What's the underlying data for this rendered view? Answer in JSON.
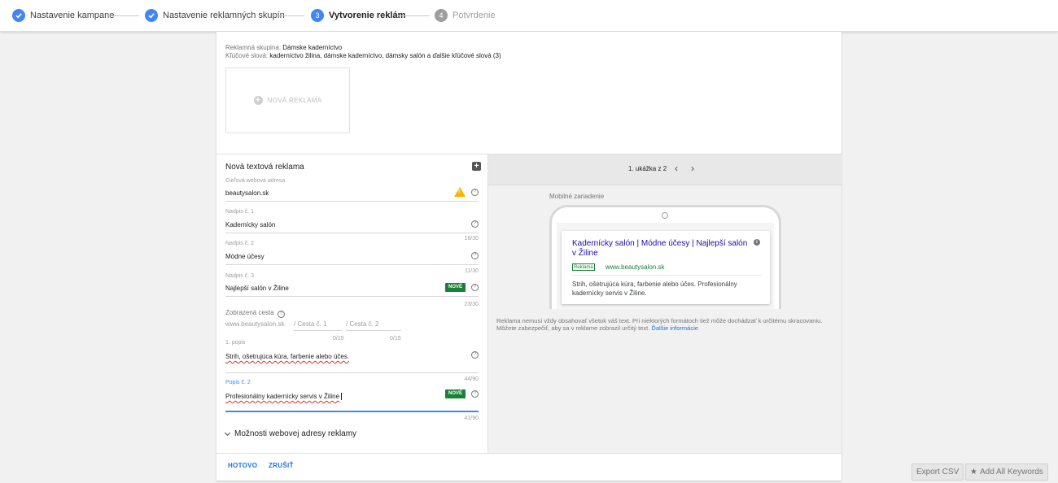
{
  "stepper": {
    "steps": [
      {
        "label": "Nastavenie kampane",
        "status": "done"
      },
      {
        "label": "Nastavenie reklamných skupín",
        "status": "done"
      },
      {
        "label": "Vytvorenie reklám",
        "number": "3",
        "status": "active"
      },
      {
        "label": "Potvrdenie",
        "number": "4",
        "status": "future"
      }
    ]
  },
  "group": {
    "ad_group_label": "Reklamná skupina:",
    "ad_group_name": "Dámske kaderníctvo",
    "keywords_label": "Kľúčové slová:",
    "keywords_value": "kaderníctvo žilina, dámske kaderníctvo, dámsky salón a ďalšie kľúčové slová (3)"
  },
  "new_ad": {
    "label": "NOVÁ REKLAMA"
  },
  "form": {
    "title": "Nová textová reklama",
    "final_url": {
      "label": "Cieľová webová adresa",
      "value": "beautysalon.sk"
    },
    "headline1": {
      "label": "Nadpis č. 1",
      "value": "Kadernícky salón",
      "counter": "16/30"
    },
    "headline2": {
      "label": "Nadpis č. 2",
      "value": "Módne účesy",
      "counter": "11/30"
    },
    "headline3": {
      "label": "Nadpis č. 3",
      "value": "Najlepší salón v Žiline",
      "counter": "23/30",
      "badge": "NOVÉ"
    },
    "display_path": {
      "label": "Zobrazená cesta",
      "domain": "www.beautysalon.sk",
      "path1_placeholder": "/ Cesta č. 1",
      "path2_placeholder": "/ Cesta č. 2",
      "path1_counter": "0/15",
      "path2_counter": "0/15"
    },
    "description1": {
      "label": "1. popis",
      "value": "Strih, ošetrujúca kúra, farbenie alebo účes.",
      "counter": "44/90"
    },
    "description2": {
      "label": "Popis č. 2",
      "value": "Profesionálny kadernícky servis v Žiline",
      "counter": "41/90",
      "badge": "NOVÉ"
    },
    "url_options_label": "Možnosti webovej adresy reklamy"
  },
  "preview": {
    "counter": "1. ukážka z 2",
    "device_label": "Mobilné zariadenie",
    "ad": {
      "title": "Kadernícky salón | Módne účesy | Najlepší salón v Žiline",
      "badge": "Reklama",
      "url": "www.beautysalon.sk",
      "description": "Strih, ošetrujúca kúra, farbenie alebo účes. Profesionálny kadernícky servis v Žiline."
    },
    "note": "Reklama nemusí vždy obsahovať všetok váš text. Pri niektorých formátoch tiež môže dochádzať k určitému skracovaniu. Môžete zabezpečiť, aby sa v reklame zobrazil určitý text.",
    "note_link": "Ďalšie informácie"
  },
  "footer": {
    "done_label": "HOTOVO",
    "cancel_label": "ZRUŠIŤ"
  },
  "ext": {
    "export_label": "Export CSV",
    "add_keywords_label": "Add All Keywords"
  },
  "colors": {
    "accent": "#4285f4",
    "link": "#1a0dab",
    "green": "#188038",
    "warning": "#f4b400"
  }
}
